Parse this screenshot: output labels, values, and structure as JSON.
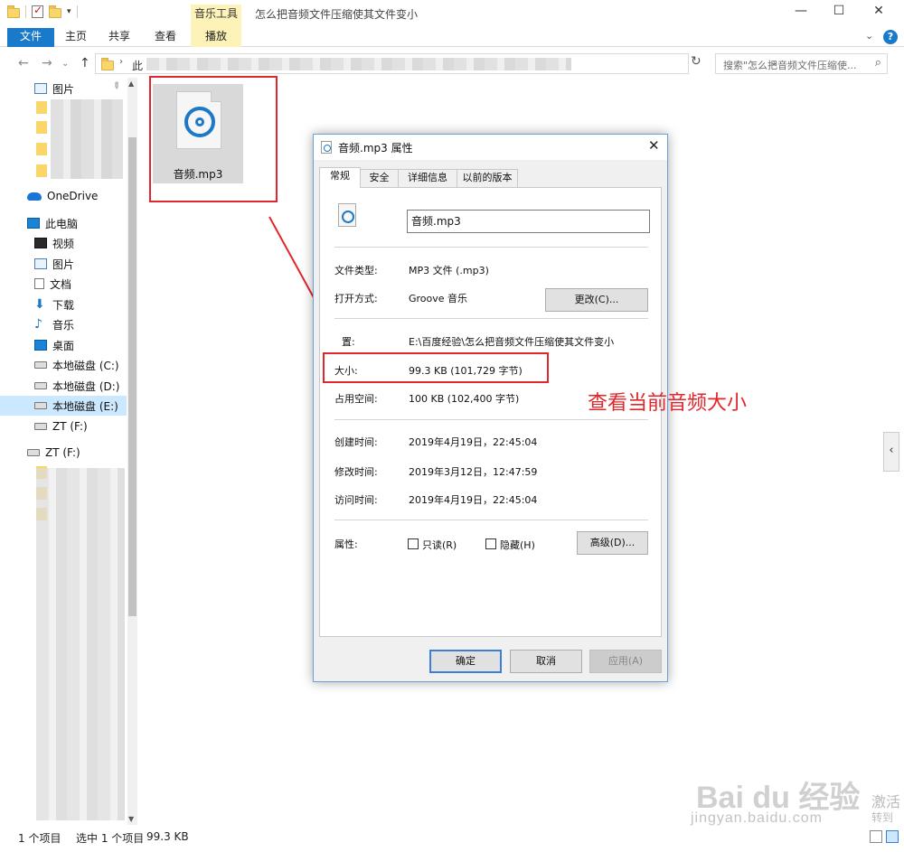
{
  "window": {
    "title": "怎么把音频文件压缩使其文件变小",
    "contextual_tab_group": "音乐工具",
    "controls": {
      "minimize": "—",
      "maximize": "☐",
      "close": "✕"
    }
  },
  "ribbon": {
    "tabs": [
      "文件",
      "主页",
      "共享",
      "查看",
      "播放"
    ],
    "collapse_glyph": "⌄",
    "help_glyph": "?"
  },
  "address": {
    "path_prefix": "此",
    "search_placeholder": "搜索\"怎么把音频文件压缩使...",
    "nav": {
      "back": "←",
      "forward": "→",
      "up": "↑",
      "dropdown": "⌄",
      "refresh": "↻",
      "recent": "⌄"
    }
  },
  "nav_pane": {
    "quick_access": [
      {
        "label": "图片",
        "icon": "pictures-icon"
      }
    ],
    "onedrive": "OneDrive",
    "this_pc": "此电脑",
    "pc_items": [
      {
        "label": "视频",
        "icon": "video-icon"
      },
      {
        "label": "图片",
        "icon": "pictures-icon"
      },
      {
        "label": "文档",
        "icon": "document-icon"
      },
      {
        "label": "下载",
        "icon": "download-icon"
      },
      {
        "label": "音乐",
        "icon": "music-icon"
      },
      {
        "label": "桌面",
        "icon": "desktop-icon"
      },
      {
        "label": "本地磁盘 (C:)",
        "icon": "drive-icon"
      },
      {
        "label": "本地磁盘 (D:)",
        "icon": "drive-icon"
      },
      {
        "label": "本地磁盘 (E:)",
        "icon": "drive-icon",
        "selected": true
      },
      {
        "label": "ZT (F:)",
        "icon": "drive-icon"
      }
    ],
    "removable": "ZT (F:)"
  },
  "file": {
    "name": "音频.mp3"
  },
  "status": {
    "item_count": "1 个项目",
    "selected": "选中 1 个项目",
    "size": "99.3 KB"
  },
  "dialog": {
    "title": "音频.mp3 属性",
    "tabs": [
      "常规",
      "安全",
      "详细信息",
      "以前的版本"
    ],
    "filename": "音频.mp3",
    "file_type_label": "文件类型:",
    "file_type": "MP3 文件 (.mp3)",
    "open_with_label": "打开方式:",
    "open_with": "Groove 音乐",
    "change_button": "更改(C)...",
    "location_label": "置:",
    "location": "E:\\百度经验\\怎么把音频文件压缩使其文件变小",
    "size_label": "大小:",
    "size": "99.3 KB (101,729 字节)",
    "disk_size_label": "占用空间:",
    "disk_size": "100 KB (102,400 字节)",
    "created_label": "创建时间:",
    "created": "2019年4月19日，22:45:04",
    "modified_label": "修改时间:",
    "modified": "2019年3月12日，12:47:59",
    "accessed_label": "访问时间:",
    "accessed": "2019年4月19日，22:45:04",
    "attributes_label": "属性:",
    "readonly_label": "只读(R)",
    "hidden_label": "隐藏(H)",
    "advanced_button": "高级(D)...",
    "ok_button": "确定",
    "cancel_button": "取消",
    "apply_button": "应用(A)"
  },
  "annotation": "查看当前音频大小",
  "watermark": {
    "brand": "Bai du 经验",
    "url": "jingyan.baidu.com",
    "activate": "激活",
    "goto": "转到"
  },
  "colors": {
    "accent": "#1979ca",
    "annotation_red": "#e2262b",
    "context_tab": "#fdf3b8",
    "selection": "#cce8ff"
  }
}
